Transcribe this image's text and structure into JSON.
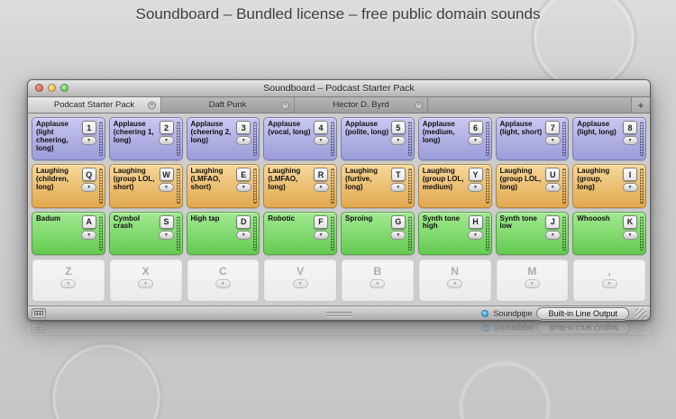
{
  "heading": "Soundboard – Bundled license – free public domain sounds",
  "window": {
    "title": "Soundboard – Podcast Starter Pack",
    "tabs": [
      {
        "label": "Podcast Starter Pack"
      },
      {
        "label": "Daft Punk"
      },
      {
        "label": "Hector D. Byrd"
      }
    ],
    "add_tab": "+",
    "statusbar": {
      "soundpipe": "Soundpipe",
      "output": "Built-in Line Output"
    }
  },
  "icons": {
    "tab_close": "×",
    "chevron_down": "▼"
  },
  "colors": {
    "applause_row": "#9c9cd9",
    "laughing_row": "#e2a94e",
    "effects_row": "#64cb51",
    "soundpipe_dot": "#1d8ecf"
  },
  "grid": {
    "rows": [
      {
        "color": "applause",
        "cells": [
          {
            "label": "Applause (light cheering, long)",
            "key": "1"
          },
          {
            "label": "Applause (cheering 1, long)",
            "key": "2"
          },
          {
            "label": "Applause (cheering 2, long)",
            "key": "3"
          },
          {
            "label": "Applause (vocal, long)",
            "key": "4"
          },
          {
            "label": "Applause (polite, long)",
            "key": "5"
          },
          {
            "label": "Applause (medium, long)",
            "key": "6"
          },
          {
            "label": "Applause (light, short)",
            "key": "7"
          },
          {
            "label": "Applause (light, long)",
            "key": "8"
          }
        ]
      },
      {
        "color": "laughing",
        "cells": [
          {
            "label": "Laughing (children, long)",
            "key": "Q"
          },
          {
            "label": "Laughing (group LOL, short)",
            "key": "W"
          },
          {
            "label": "Laughing (LMFAO, short)",
            "key": "E"
          },
          {
            "label": "Laughing (LMFAO, long)",
            "key": "R"
          },
          {
            "label": "Laughing (furtive, long)",
            "key": "T"
          },
          {
            "label": "Laughing (group LOL, medium)",
            "key": "Y"
          },
          {
            "label": "Laughing (group LOL, long)",
            "key": "U"
          },
          {
            "label": "Laughing (group, long)",
            "key": "I"
          }
        ]
      },
      {
        "color": "effects",
        "cells": [
          {
            "label": "Badum",
            "key": "A"
          },
          {
            "label": "Cymbol crash",
            "key": "S"
          },
          {
            "label": "High tap",
            "key": "D"
          },
          {
            "label": "Robotic",
            "key": "F"
          },
          {
            "label": "Sproing",
            "key": "G"
          },
          {
            "label": "Synth tone high",
            "key": "H"
          },
          {
            "label": "Synth tone low",
            "key": "J"
          },
          {
            "label": "Whooosh",
            "key": "K"
          }
        ]
      },
      {
        "color": "empty",
        "cells": [
          {
            "label": "",
            "key": "Z"
          },
          {
            "label": "",
            "key": "X"
          },
          {
            "label": "",
            "key": "C"
          },
          {
            "label": "",
            "key": "V"
          },
          {
            "label": "",
            "key": "B"
          },
          {
            "label": "",
            "key": "N"
          },
          {
            "label": "",
            "key": "M"
          },
          {
            "label": "",
            "key": ","
          }
        ]
      }
    ]
  }
}
